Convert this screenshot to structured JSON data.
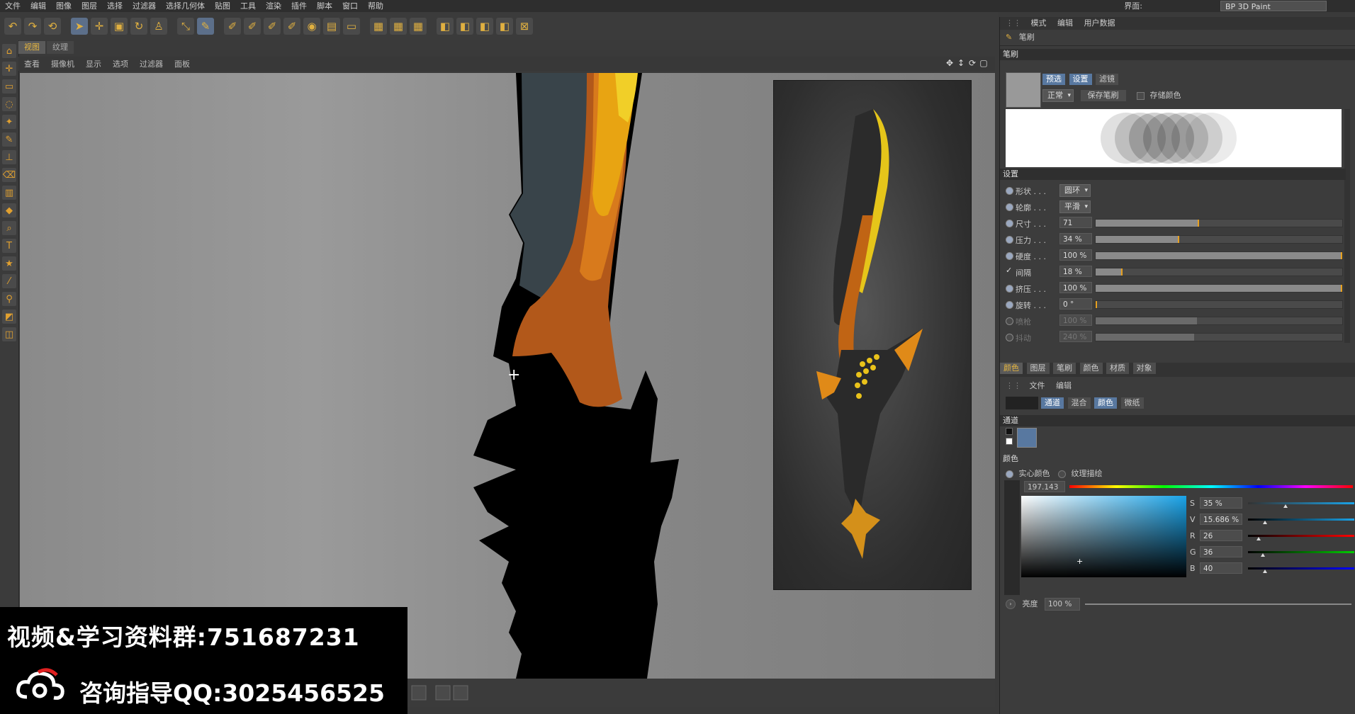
{
  "menu": [
    "文件",
    "编辑",
    "图像",
    "图层",
    "选择",
    "过滤器",
    "选择几何体",
    "贴图",
    "工具",
    "渲染",
    "插件",
    "脚本",
    "窗口",
    "帮助"
  ],
  "layout": {
    "label": "界面:",
    "value": "BP 3D Paint"
  },
  "view_tabs": [
    "视图",
    "纹理"
  ],
  "view_menu": [
    "查看",
    "摄像机",
    "显示",
    "选项",
    "过滤器",
    "面板"
  ],
  "panel": {
    "top_menu": [
      "模式",
      "编辑",
      "用户数据"
    ],
    "title": "笔刷",
    "brush_section": "笔刷",
    "brush_tabs": [
      "预选",
      "设置",
      "滤镜"
    ],
    "mode_dropdown": "正常",
    "save_brush_button": "保存笔刷",
    "store_color_label": "存储颜色",
    "settings_section": "设置",
    "settings": [
      {
        "label": "形状 . . .",
        "value": "圆环",
        "kind": "dropdown"
      },
      {
        "label": "轮廓 . . .",
        "value": "平滑",
        "kind": "dropdown"
      },
      {
        "label": "尺寸 . . .",
        "value": "71",
        "kind": "slider",
        "fraction": 0.42
      },
      {
        "label": "压力 . . .",
        "value": "34 %",
        "kind": "slider",
        "fraction": 0.34
      },
      {
        "label": "硬度 . . .",
        "value": "100 %",
        "kind": "slider",
        "fraction": 1.0
      },
      {
        "label": "间隔",
        "value": "18 %",
        "kind": "slider",
        "fraction": 0.11,
        "check": "✓"
      },
      {
        "label": "挤压 . . .",
        "value": "100 %",
        "kind": "slider",
        "fraction": 1.0
      },
      {
        "label": "旋转 . . .",
        "value": "0 °",
        "kind": "slider",
        "fraction": 0.0
      },
      {
        "label": "喷枪",
        "value": "100 %",
        "kind": "slider",
        "fraction": 0.41,
        "dim": true
      },
      {
        "label": "抖动",
        "value": "240 %",
        "kind": "slider",
        "fraction": 0.4,
        "dim": true
      }
    ],
    "lower_tabs": [
      "颜色",
      "图层",
      "笔刷",
      "颜色",
      "材质",
      "对象"
    ],
    "lower_menu": [
      "文件",
      "编辑"
    ],
    "channel_tabs": [
      "通道",
      "混合",
      "颜色",
      "微纸"
    ],
    "channel_section": "通道",
    "color_section": "颜色",
    "solid_color_label": "实心颜色",
    "texture_label": "纹理描绘",
    "hue_value": "197.143",
    "color_fields": [
      {
        "label": "S",
        "value": "35 %",
        "fraction": 0.35
      },
      {
        "label": "V",
        "value": "15.686 %",
        "fraction": 0.16
      },
      {
        "label": "R",
        "value": "26",
        "fraction": 0.1
      },
      {
        "label": "G",
        "value": "36",
        "fraction": 0.14
      },
      {
        "label": "B",
        "value": "40",
        "fraction": 0.16
      }
    ],
    "brightness_label": "亮度",
    "brightness_value": "100 %"
  },
  "watermark": {
    "line1": "视频&学习资料群:751687231",
    "line2": "咨询指导QQ:3025456525"
  },
  "colors": {
    "accent": "#e6a020",
    "active_tab": "#5878a0"
  }
}
